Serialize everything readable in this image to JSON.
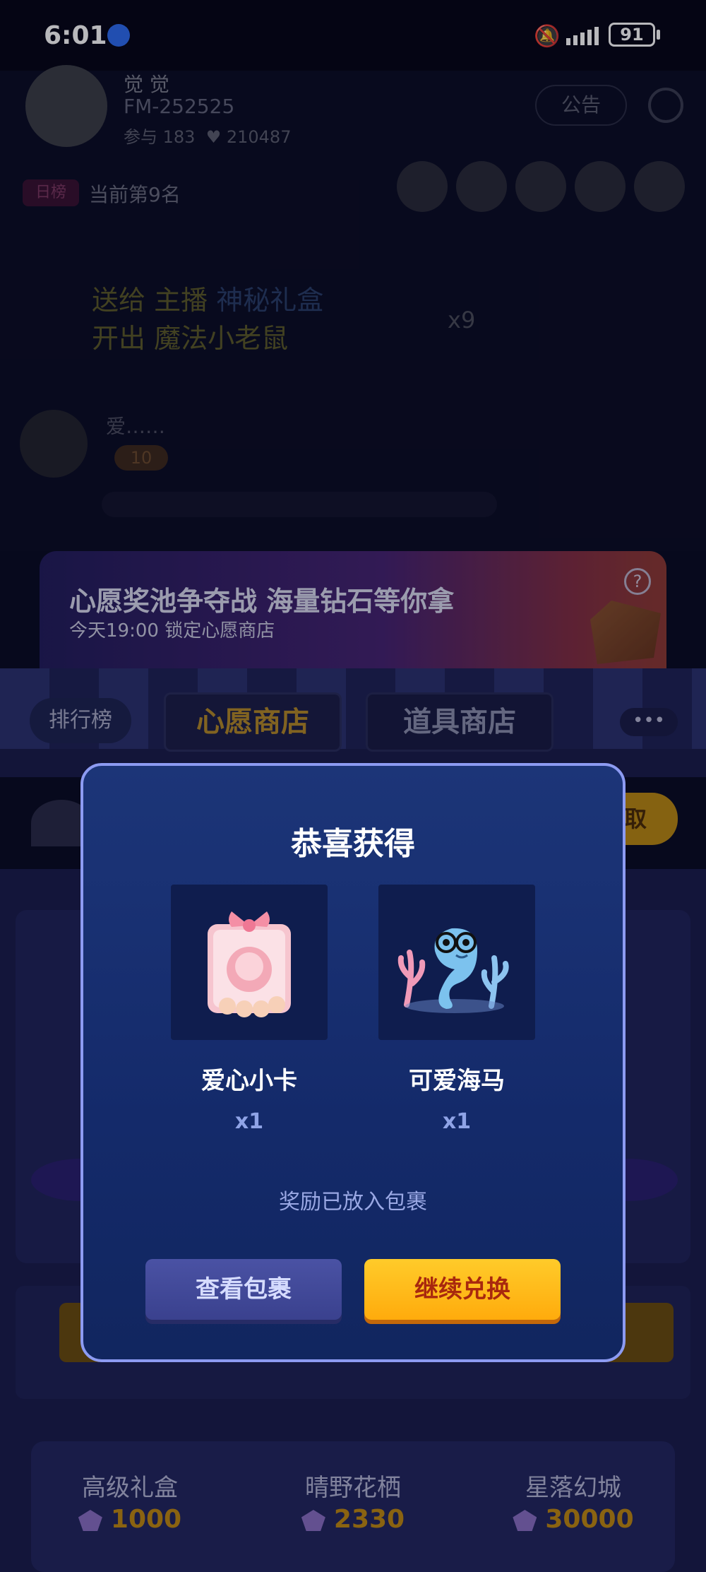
{
  "status_bar": {
    "time": "6:01",
    "battery": "91",
    "icons": [
      "app-icon",
      "bell-off-icon",
      "signal-icon",
      "battery-icon"
    ]
  },
  "room": {
    "host_name": "觉 觉",
    "host_id": "FM-252525",
    "participants": "参与 183",
    "likes": "210487",
    "notice_label": "公告",
    "rank_tag": "日榜",
    "rank_text": "当前第9名",
    "gift_line1_prefix": "送给 主播",
    "gift_line1_item": "神秘礼盒",
    "gift_line2_prefix": "开出",
    "gift_line2_item": "魔法小老鼠",
    "gift_count": "x9",
    "chat_name": "爱……",
    "chat_level": "10"
  },
  "wish_banner": {
    "title": "心愿奖池争夺战 海量钻石等你拿",
    "subtitle": "今天19:00 锁定心愿商店",
    "help": "?"
  },
  "shop_tabs": {
    "rank": "排行榜",
    "wish_shop": "心愿商店",
    "item_shop": "道具商店",
    "more": "•••",
    "claim": "取"
  },
  "modal": {
    "title": "恭喜获得",
    "prizes": [
      {
        "name": "爱心小卡",
        "qty": "x1"
      },
      {
        "name": "可爱海马",
        "qty": "x1"
      }
    ],
    "note": "奖励已放入包裹",
    "view_button": "查看包裹",
    "continue_button": "继续兑换"
  },
  "packages": [
    {
      "name": "高级礼盒",
      "price": "1000"
    },
    {
      "name": "晴野花栖",
      "price": "2330"
    },
    {
      "name": "星落幻城",
      "price": "30000"
    }
  ],
  "colors": {
    "modal_border": "#8d9bf2",
    "modal_bg": "#1c3578",
    "continue_btn": "#ffb814",
    "continue_text": "#a8280e",
    "view_btn": "#4a52a4"
  }
}
